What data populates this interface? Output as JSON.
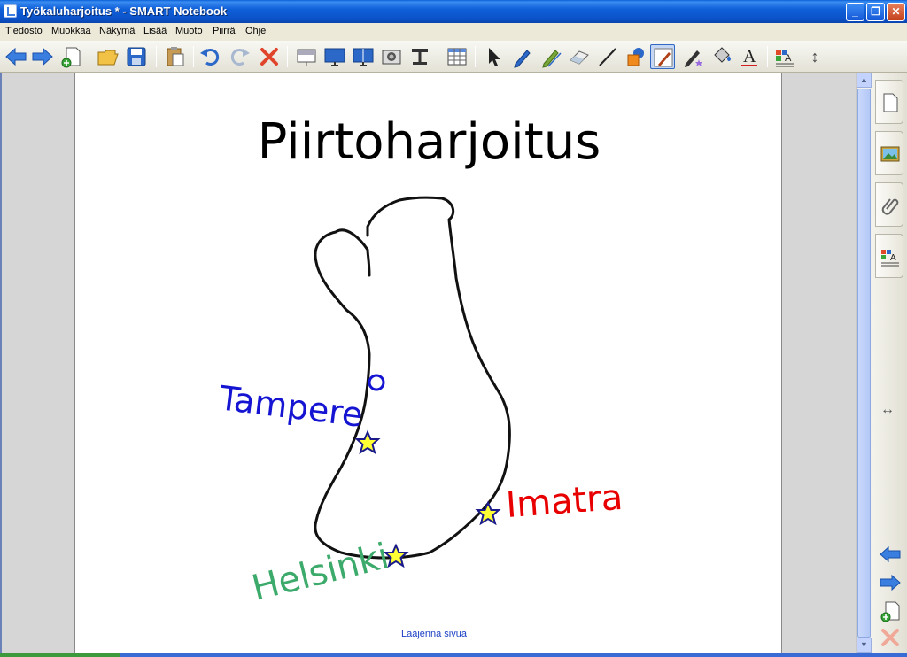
{
  "window": {
    "title": "Työkaluharjoitus * - SMART Notebook",
    "minimize_glyph": "_",
    "maximize_glyph": "❐",
    "close_glyph": "✕"
  },
  "menu": {
    "items": [
      "Tiedosto",
      "Muokkaa",
      "Näkymä",
      "Lisää",
      "Muoto",
      "Piirrä",
      "Ohje"
    ]
  },
  "toolbar": {
    "icons": [
      "back-arrow-icon",
      "forward-arrow-icon",
      "new-page-icon",
      "open-folder-icon",
      "save-icon",
      "paste-icon",
      "undo-icon",
      "redo-icon",
      "delete-icon",
      "screen-shade-icon",
      "full-screen-icon",
      "dual-page-icon",
      "capture-icon",
      "document-camera-icon",
      "table-icon",
      "select-icon",
      "pen-icon",
      "creative-pen-icon",
      "eraser-icon",
      "line-icon",
      "shapes-icon",
      "magic-pen-icon",
      "shape-recognition-pen-icon",
      "fill-icon",
      "text-icon",
      "properties-icon",
      "toolbar-position-icon"
    ],
    "active_tool": "magic-pen-icon",
    "text_tool_glyph": "A",
    "position_glyph": "↕"
  },
  "page": {
    "title": "Piirtoharjoitus",
    "expand_link": "Laajenna sivua",
    "labels": {
      "tampere": "Tampere",
      "imatra": "Imatra",
      "helsinki": "Helsinki"
    },
    "colors": {
      "tampere": "#1414d2",
      "imatra": "#e80000",
      "helsinki": "#3caa6a",
      "star_fill": "#ffff33",
      "star_stroke": "#1a1a8a"
    }
  },
  "side_tabs": {
    "items": [
      "page-sorter-tab",
      "gallery-tab",
      "attachments-tab",
      "properties-tab"
    ],
    "resize_glyph": "↔"
  },
  "navigation": {
    "prev_icon": "previous-page-icon",
    "next_icon": "next-page-icon",
    "add_icon": "add-page-icon",
    "delete_icon": "delete-page-icon"
  }
}
